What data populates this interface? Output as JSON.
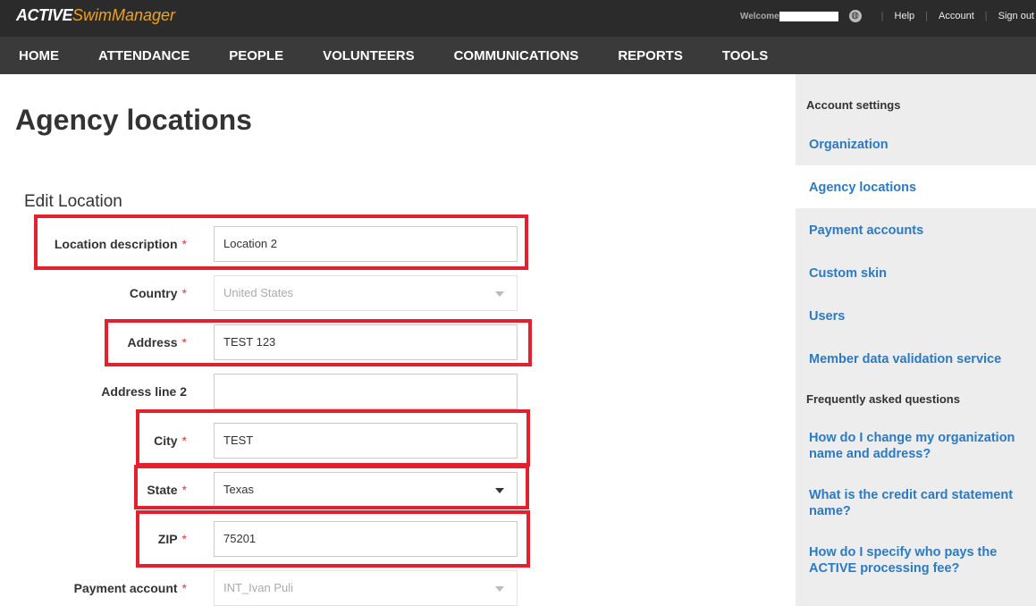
{
  "app": {
    "logo_active": "ACTIVE",
    "logo_product": "SwimManager"
  },
  "topbar": {
    "welcome": "Welcome",
    "help": "Help",
    "account": "Account",
    "signout": "Sign out"
  },
  "nav": [
    "HOME",
    "ATTENDANCE",
    "PEOPLE",
    "VOLUNTEERS",
    "COMMUNICATIONS",
    "REPORTS",
    "TOOLS"
  ],
  "page": {
    "title": "Agency locations",
    "section": "Edit Location"
  },
  "form": {
    "required_mark": "*",
    "location_description": {
      "label": "Location description",
      "value": "Location 2"
    },
    "country": {
      "label": "Country",
      "value": "United States"
    },
    "address": {
      "label": "Address",
      "value": "TEST 123"
    },
    "address2": {
      "label": "Address line 2",
      "value": ""
    },
    "city": {
      "label": "City",
      "value": "TEST"
    },
    "state": {
      "label": "State",
      "value": "Texas"
    },
    "zip": {
      "label": "ZIP",
      "value": "75201"
    },
    "payment_account": {
      "label": "Payment account",
      "value": "INT_Ivan Puli"
    }
  },
  "sidebar": {
    "account_heading": "Account settings",
    "links": [
      "Organization",
      "Agency locations",
      "Payment accounts",
      "Custom skin",
      "Users",
      "Member data validation service"
    ],
    "active_link": "Agency locations",
    "faq_heading": "Frequently asked questions",
    "faq": [
      "How do I change my organization name and address?",
      "What is the credit card statement name?",
      "How do I specify who pays the ACTIVE processing fee?"
    ]
  },
  "colors": {
    "highlight": "#e3202e",
    "link": "#2a7ac5",
    "required": "#e03a3a",
    "topbar": "#2b2b2b",
    "nav": "#3a3a3a"
  }
}
